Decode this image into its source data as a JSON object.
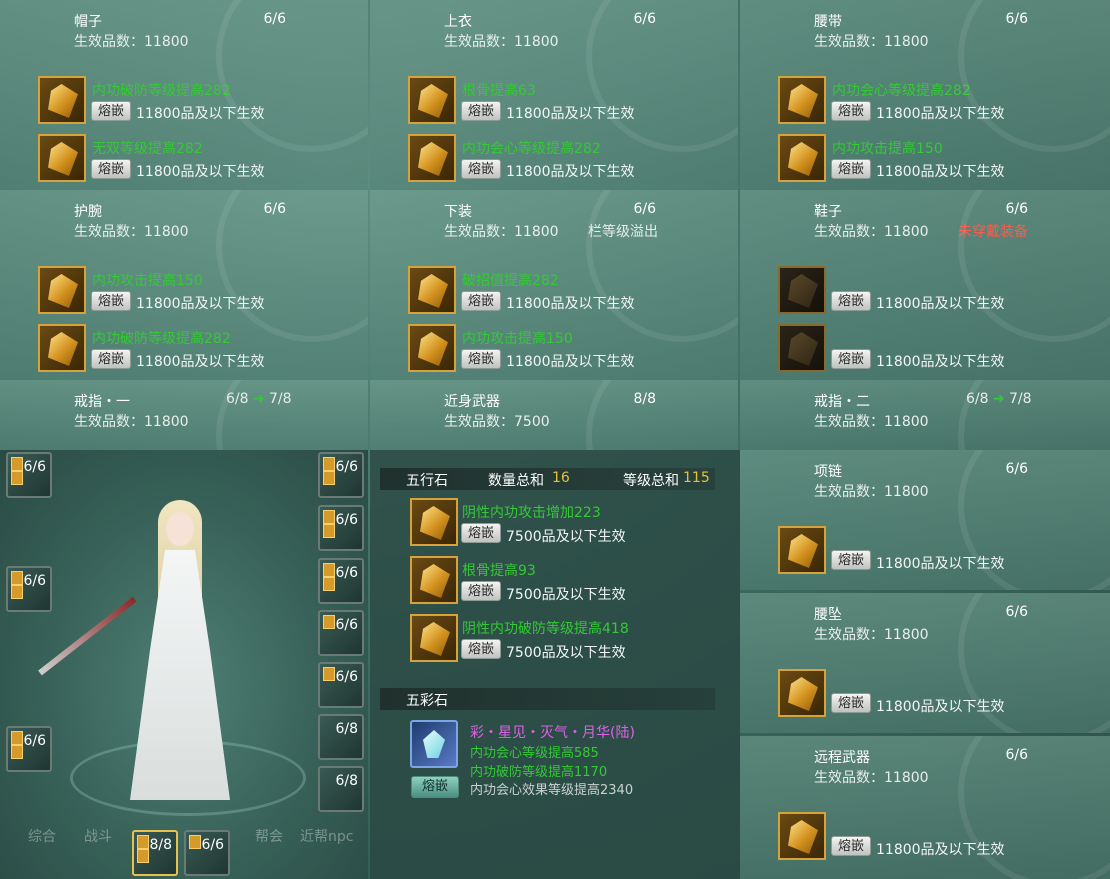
{
  "common": {
    "inlay_label": "熔嵌",
    "effect_suffix_11800": "11800品及以下生效",
    "effect_suffix_7500": "7500品及以下生效",
    "eff_prefix": "生效品数：11800"
  },
  "panels": {
    "hat": {
      "title": "帽子",
      "count": "6/6",
      "eff": "生效品数：11800",
      "attr1": "内功破防等级提高282",
      "attr2": "无双等级提高282"
    },
    "top": {
      "title": "上衣",
      "count": "6/6",
      "eff": "生效品数：11800",
      "attr1": "根骨提高63",
      "attr2": "内功会心等级提高282"
    },
    "belt": {
      "title": "腰带",
      "count": "6/6",
      "eff": "生效品数：11800",
      "attr1": "内功会心等级提高282",
      "attr2": "内功攻击提高150"
    },
    "wrist": {
      "title": "护腕",
      "count": "6/6",
      "eff": "生效品数：11800",
      "attr1": "内功攻击提高150",
      "attr2": "内功破防等级提高282"
    },
    "pants": {
      "title": "下装",
      "count": "6/6",
      "eff": "生效品数：11800",
      "note": "栏等级溢出",
      "attr1": "破招值提高282",
      "attr2": "内功攻击提高150"
    },
    "shoes": {
      "title": "鞋子",
      "count": "6/6",
      "eff": "生效品数：11800",
      "note": "未穿戴装备"
    },
    "ring1": {
      "title": "戒指・一",
      "count": "6/8",
      "count_next": "7/8",
      "eff": "生效品数：11800"
    },
    "melee": {
      "title": "近身武器",
      "count": "8/8",
      "eff": "生效品数：7500"
    },
    "ring2": {
      "title": "戒指・二",
      "count": "6/8",
      "count_next": "7/8",
      "eff": "生效品数：11800"
    },
    "necklace": {
      "title": "项链",
      "count": "6/6",
      "eff": "生效品数：11800"
    },
    "pendant": {
      "title": "腰坠",
      "count": "6/6",
      "eff": "生效品数：11800"
    },
    "ranged": {
      "title": "远程武器",
      "count": "6/6",
      "eff": "生效品数：11800"
    }
  },
  "wuxing": {
    "label": "五行石",
    "qty_label": "数量总和",
    "qty": "16",
    "lvl_label": "等级总和",
    "lvl": "115",
    "attrs": [
      "阴性内功攻击增加223",
      "根骨提高93",
      "阴性内功破防等级提高418"
    ]
  },
  "wucai": {
    "label": "五彩石",
    "name": "彩・星见・灭气・月华(陆)",
    "lines": [
      "内功会心等级提高585",
      "内功破防等级提高1170",
      "内功会心效果等级提高2340"
    ]
  },
  "minislots": {
    "left": [
      "6/6",
      "6/6",
      "6/6"
    ],
    "right": [
      "6/6",
      "6/6",
      "6/6",
      "6/6",
      "6/6",
      "6/8",
      "6/8"
    ],
    "bottom": [
      "8/8",
      "6/6"
    ]
  },
  "tabs": [
    "综合",
    "战斗",
    "帮会",
    "近帮npc"
  ]
}
